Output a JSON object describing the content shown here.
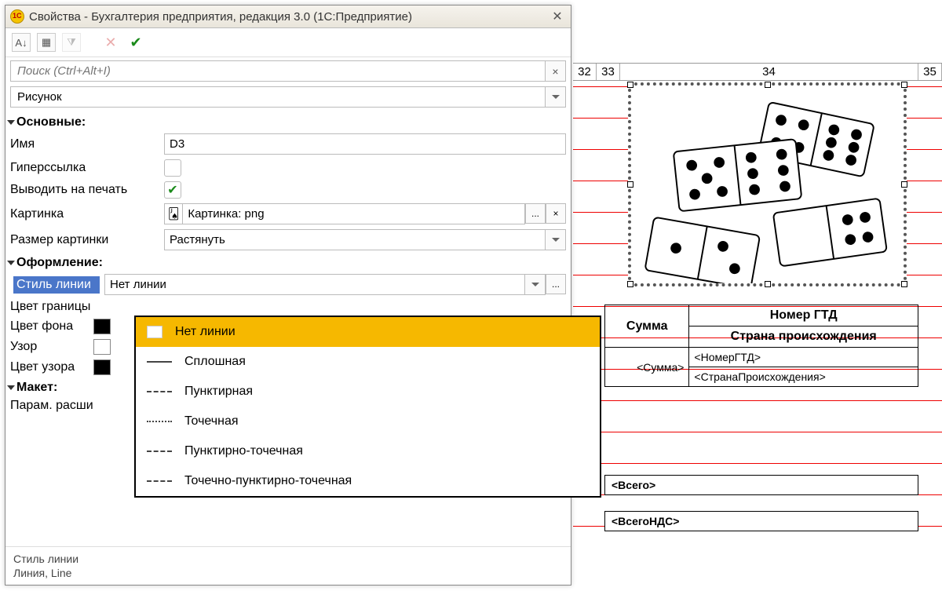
{
  "window": {
    "title": "Свойства - Бухгалтерия предприятия, редакция 3.0  (1С:Предприятие)"
  },
  "search": {
    "placeholder": "Поиск (Ctrl+Alt+I)"
  },
  "category_select": "Рисунок",
  "sections": {
    "main": "Основные:",
    "style": "Оформление:",
    "layout": "Макет:"
  },
  "props": {
    "name_label": "Имя",
    "name_value": "D3",
    "hyperlink_label": "Гиперссылка",
    "print_label": "Выводить на печать",
    "picture_label": "Картинка",
    "picture_value": "Картинка: png",
    "picsize_label": "Размер картинки",
    "picsize_value": "Растянуть",
    "linestyle_label": "Стиль линии",
    "linestyle_value": "Нет линии",
    "bordercolor_label": "Цвет границы",
    "bgcolor_label": "Цвет фона",
    "pattern_label": "Узор",
    "patterncolor_label": "Цвет узора",
    "paramext_label": "Парам. расши"
  },
  "dropdown_items": [
    "Нет линии",
    "Сплошная",
    "Пунктирная",
    "Точечная",
    "Пунктирно-точечная",
    "Точечно-пунктирно-точечная"
  ],
  "status": {
    "line1": "Стиль линии",
    "line2": "Линия, Line"
  },
  "sheet": {
    "cols": {
      "c32": "32",
      "c33": "33",
      "c34": "34",
      "c35": "35"
    },
    "table": {
      "summa": "Сумма",
      "gtd": "Номер ГТД",
      "origin": "Страна происхождения",
      "summa_ph": "<Сумма>",
      "gtd_ph": "<НомерГТД>",
      "origin_ph": "<СтранаПроисхождения>",
      "total": "<Всего>",
      "total_vat": "<ВсегоНДС>"
    }
  }
}
